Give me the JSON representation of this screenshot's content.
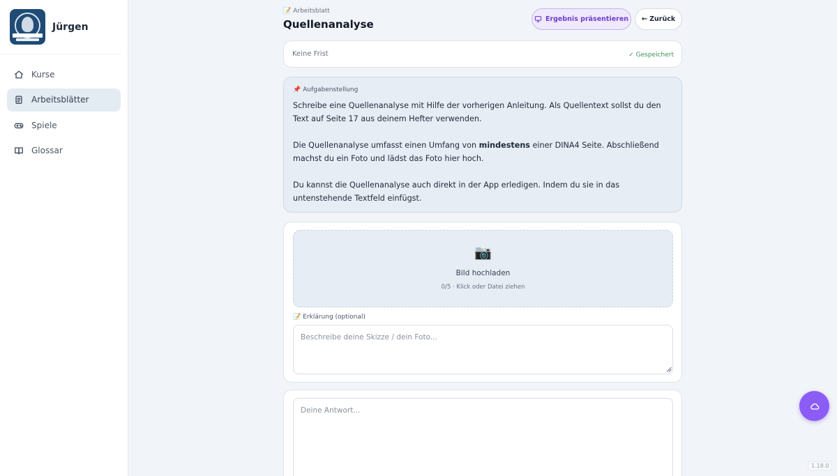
{
  "sidebar": {
    "user_name": "Jürgen",
    "items": [
      {
        "label": "Kurse",
        "icon": "home-icon",
        "active": false
      },
      {
        "label": "Arbeitsblätter",
        "icon": "clipboard-icon",
        "active": true
      },
      {
        "label": "Spiele",
        "icon": "gamepad-icon",
        "active": false
      },
      {
        "label": "Glossar",
        "icon": "book-icon",
        "active": false
      }
    ]
  },
  "header": {
    "crumb_icon": "memo-icon",
    "crumb": "Arbeitsblatt",
    "title": "Quellenanalyse",
    "present_label": "Ergebnis präsentieren",
    "back_label": "Zurück"
  },
  "deadline": {
    "text": "Keine Frist",
    "saved": "✓ Gespeichert"
  },
  "task": {
    "label": "Aufgabenstellung",
    "p1": "Schreibe eine Quellenanalyse mit Hilfe der vorherigen Anleitung. Als Quellentext sollst du den Text auf Seite 17 aus deinem Hefter verwenden.",
    "p2_before": "Die Quellenanalyse umfasst einen Umfang von ",
    "p2_bold": "mindestens",
    "p2_after": " einer DINA4 Seite. Abschließend machst du ein Foto und lädst das Foto hier hoch.",
    "p3": "Du kannst die Quellenanalyse auch direkt in der App erledigen. Indem du sie in das untenstehende Textfeld einfügst."
  },
  "upload": {
    "icon": "camera-icon",
    "title": "Bild hochladen",
    "hint": "0/5 · Klick oder Datei ziehen",
    "explanation_label": "Erklärung (optional)",
    "explanation_placeholder": "Beschreibe deine Skizze / dein Foto..."
  },
  "answer": {
    "placeholder": "Deine Antwort..."
  },
  "version": "1.18.0",
  "colors": {
    "accent": "#8b5cf6",
    "accent_dark": "#6d3fd0",
    "saved_green": "#3f8f5a",
    "logo_navy": "#1f4b75"
  }
}
